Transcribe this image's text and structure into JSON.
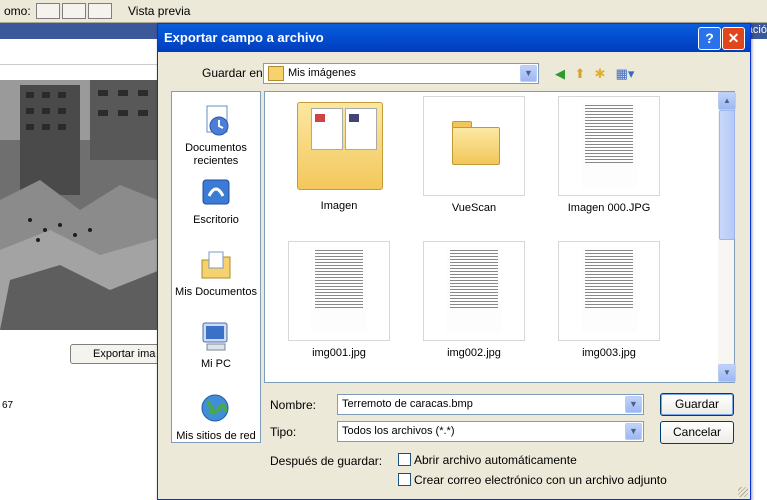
{
  "background": {
    "toolbar_label": "omo:",
    "preview_label": "Vista previa",
    "bar_right_text": "ació",
    "export_button": "Exportar ima",
    "footer_number": "67"
  },
  "dialog": {
    "title": "Exportar campo a archivo",
    "help_label": "?",
    "close_label": "✕",
    "save_in_label": "Guardar en:",
    "save_in_value": "Mis imágenes",
    "toolbar_icons": [
      "back-icon",
      "up-folder-icon",
      "new-folder-icon",
      "views-menu-icon"
    ],
    "places": [
      {
        "label": "Documentos recientes",
        "icon": "recent-documents-icon"
      },
      {
        "label": "Escritorio",
        "icon": "desktop-icon"
      },
      {
        "label": "Mis Documentos",
        "icon": "my-documents-icon"
      },
      {
        "label": "Mi PC",
        "icon": "my-computer-icon"
      },
      {
        "label": "Mis sitios de red",
        "icon": "network-places-icon"
      }
    ],
    "files": [
      {
        "name": "Imagen",
        "type": "folder"
      },
      {
        "name": "VueScan",
        "type": "folder"
      },
      {
        "name": "Imagen 000.JPG",
        "type": "image"
      },
      {
        "name": "img001.jpg",
        "type": "image"
      },
      {
        "name": "img002.jpg",
        "type": "image"
      },
      {
        "name": "img003.jpg",
        "type": "image"
      }
    ],
    "filename_label": "Nombre:",
    "filename_value": "Terremoto de caracas.bmp",
    "filetype_label": "Tipo:",
    "filetype_value": "Todos los archivos (*.*)",
    "save_button": "Guardar",
    "cancel_button": "Cancelar",
    "after_save_label": "Después de guardar:",
    "option_open": "Abrir archivo automáticamente",
    "option_email": "Crear correo electrónico con un archivo adjunto"
  },
  "colors": {
    "titlebar": "#0450d4",
    "dialog_bg": "#ece9d8",
    "close": "#e0461c"
  }
}
